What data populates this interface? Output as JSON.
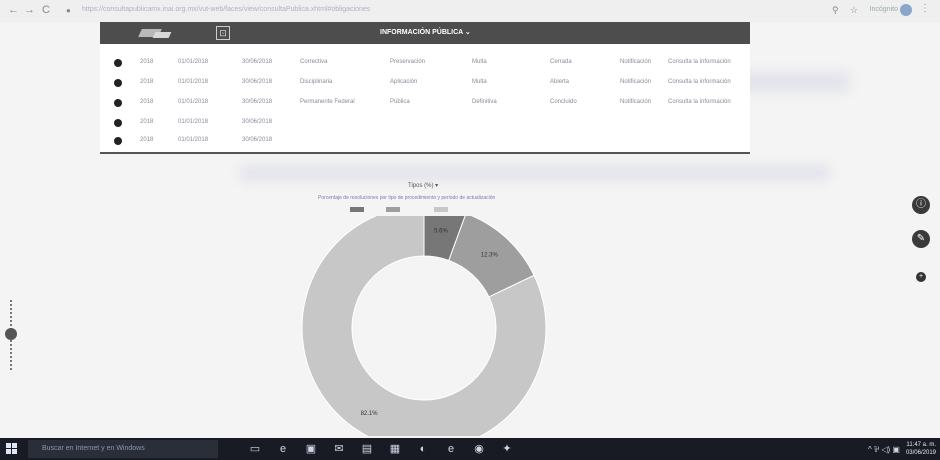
{
  "browser": {
    "back": "←",
    "forward": "→",
    "reload": "C",
    "url": "https://consultapublicamx.inai.org.mx/vut-web/faces/view/consultaPublica.xhtml#obligaciones",
    "profile_label": "Incógnito",
    "menu": "⋮"
  },
  "header": {
    "menu_glyph": "⊡",
    "title": "INFORMACIÓN PÚBLICA ⌄"
  },
  "table": {
    "rows": [
      [
        "2018",
        "01/01/2018",
        "30/06/2018",
        "Correctiva",
        "Preservación",
        "Multa",
        "Cerrada",
        "Notificación",
        "Consulta la información"
      ],
      [
        "2018",
        "01/01/2018",
        "30/06/2018",
        "Disciplinaria",
        "Aplicación",
        "Multa",
        "Abierta",
        "Notificación",
        "Consulta la información"
      ],
      [
        "2018",
        "01/01/2018",
        "30/06/2018",
        "Permanente Federal",
        "Pública",
        "Definitiva",
        "Concluido",
        "Notificación",
        "Consulta la información"
      ],
      [
        "2018",
        "01/01/2018",
        "30/06/2018",
        "",
        "",
        "",
        "",
        "",
        ""
      ],
      [
        "2018",
        "01/01/2018",
        "30/06/2018",
        "",
        "",
        "",
        "",
        "",
        ""
      ]
    ]
  },
  "chart": {
    "title": "Tipos (%) ▾",
    "subtitle": "Porcentaje de resoluciones por tipo de procedimiento y periodo de actualización",
    "legend": [
      "",
      "",
      ""
    ]
  },
  "chart_data": {
    "type": "pie",
    "style": "donut",
    "slices": [
      {
        "label": "5.6%",
        "value": 5.6,
        "color": "#777777"
      },
      {
        "label": "12.3%",
        "value": 12.3,
        "color": "#9e9e9e"
      },
      {
        "label": "82.1%",
        "value": 82.1,
        "color": "#c7c7c7"
      }
    ]
  },
  "side": {
    "info_glyph": "ⓘ",
    "tool_glyph": "✎",
    "plus_glyph": "+"
  },
  "taskbar": {
    "search_placeholder": "Buscar en Internet y en Windows",
    "icons": [
      "▭",
      "e",
      "▣",
      "✉",
      "▤",
      "▦",
      "◐",
      "e",
      "◉",
      "✦"
    ],
    "tray": "^ ⅌ ◁) ▣",
    "time": "11:47 a. m.",
    "date": "03/06/2019"
  },
  "colors": {
    "header": "#4d4d4d",
    "taskbar": "#181b24",
    "accent": "#3a3a3a"
  }
}
